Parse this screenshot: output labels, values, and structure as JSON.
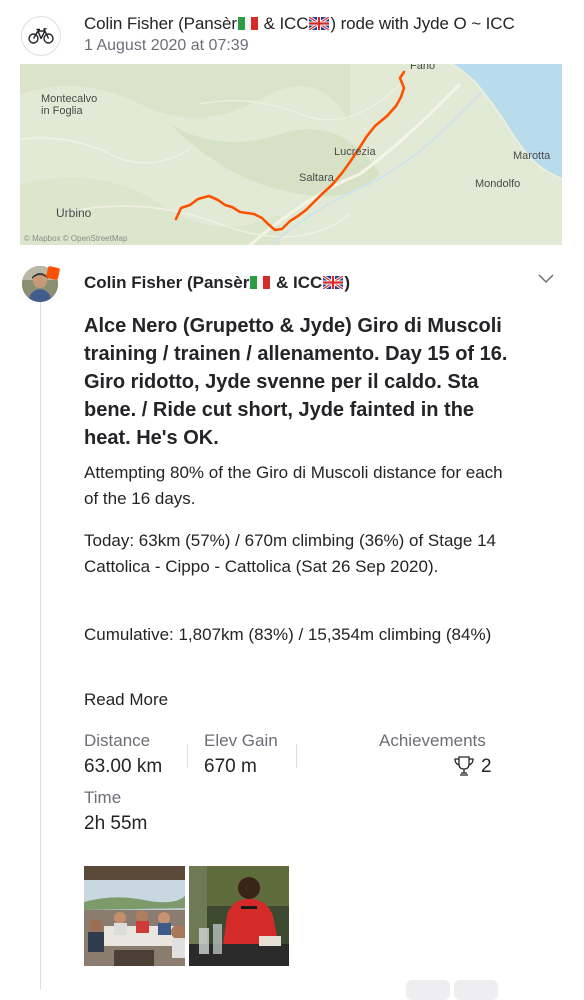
{
  "group": {
    "title_prefix": "Colin Fisher (Pansèr",
    "title_mid": " & ICC",
    "title_suffix": ") rode with Jyde O ~ ICC",
    "date": "1 August 2020 at 07:39",
    "icon": "bicycle-icon"
  },
  "map": {
    "labels": {
      "montecalvo": "Montecalvo\nin Foglia",
      "fano": "Fano",
      "lucrezia": "Lucrezia",
      "saltara": "Saltara",
      "marotta": "Marotta",
      "mondolfo": "Mondolfo",
      "urbino": "Urbino"
    },
    "credit": "© Mapbox © OpenStreetMap",
    "route_color": "#fc5200"
  },
  "activity": {
    "athlete_prefix": "Colin Fisher (Pansèr",
    "athlete_mid": " & ICC",
    "athlete_suffix": ")",
    "title": "Alce Nero (Grupetto & Jyde) Giro di Muscoli training / trainen / allenamento. Day 15 of 16. Giro ridotto, Jyde svenne per il caldo. Sta bene. / Ride cut short, Jyde fainted in the heat. He's OK.",
    "description": [
      "Attempting 80% of the Giro di Muscoli distance for each of the 16 days.",
      "Today: 63km (57%) / 670m climbing (36%) of Stage 14 Cattolica - Cippo - Cattolica (Sat 26 Sep 2020).",
      "Cumulative: 1,807km (83%) / 15,354m climbing (84%)"
    ],
    "read_more": "Read More",
    "stats": {
      "distance_label": "Distance",
      "distance_value": "63.00 km",
      "elev_label": "Elev Gain",
      "elev_value": "670 m",
      "achievements_label": "Achievements",
      "achievements_value": "2",
      "time_label": "Time",
      "time_value": "2h 55m"
    }
  },
  "colors": {
    "accent": "#fc5200",
    "text": "#242428",
    "muted": "#6d6d78"
  }
}
